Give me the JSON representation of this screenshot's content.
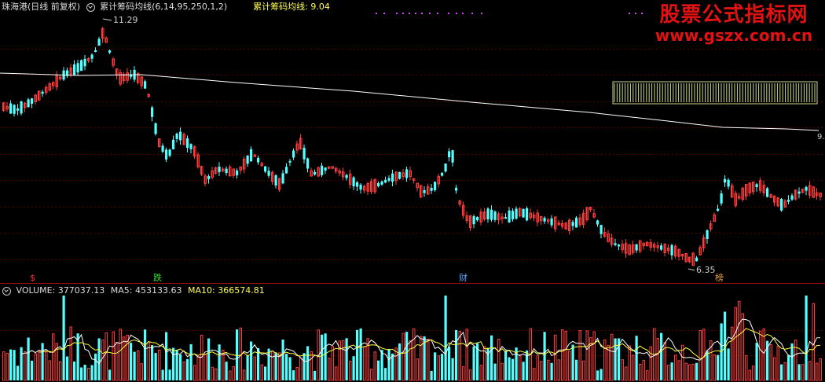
{
  "header": {
    "stock_title": "珠海港(日线 前复权)",
    "indicator_name": "累计筹码均线",
    "indicator_params": "(6,14,95,250,1,2)",
    "indicator_value_label": "累计筹码均线:",
    "indicator_value": "9.04"
  },
  "price_panel": {
    "high_label": "11.29",
    "low_label": "6.35",
    "right_edge_label": "9.",
    "markers": [
      {
        "text": "$",
        "color": "#ff3030"
      },
      {
        "text": "跌",
        "color": "#38e038"
      },
      {
        "text": "财",
        "color": "#5aa0ff"
      },
      {
        "text": "榜",
        "color": "#e0a040"
      }
    ]
  },
  "volume_panel": {
    "label": "VOLUME:",
    "volume_value": "377037.13",
    "ma5_label": "MA5:",
    "ma5_value": "453133.63",
    "ma10_label": "MA10:",
    "ma10_value": "366574.81"
  },
  "watermark": {
    "title": "股票公式指标网",
    "url": "www.gszx.com.cn"
  },
  "colors": {
    "up": "#ff3c3c",
    "down": "#54ffff",
    "ma_line": "#ffffff",
    "ma10_line": "#ffff40",
    "divider": "#a01010",
    "grid": "#5a0000",
    "chip_box": "#c8d888",
    "dots": "#d040ff"
  }
}
